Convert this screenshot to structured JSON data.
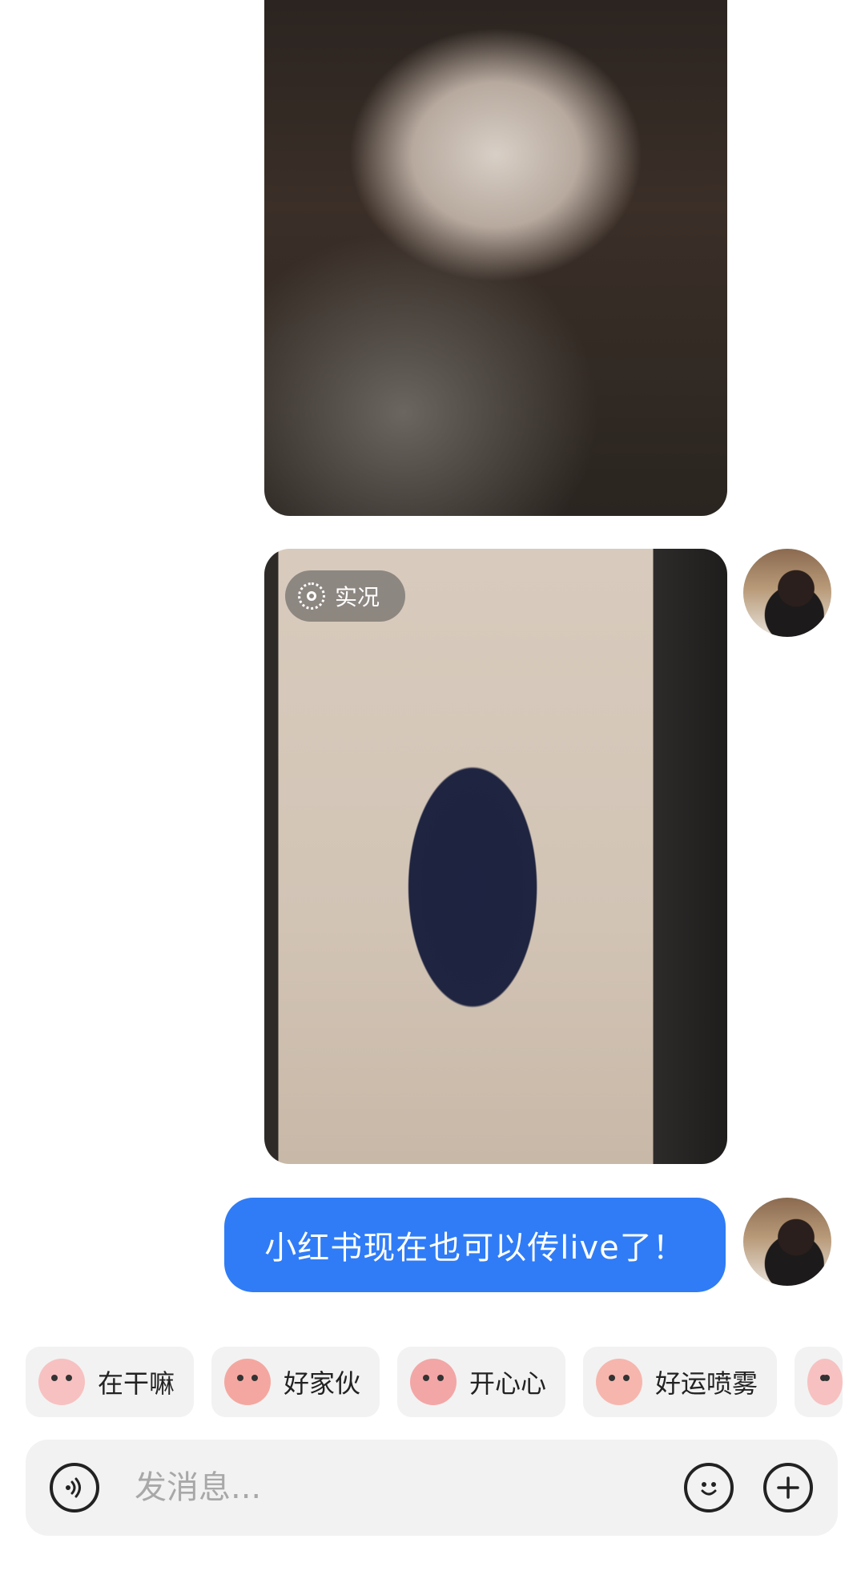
{
  "messages": {
    "live_badge_label": "实况",
    "text_message": "小红书现在也可以传live了！"
  },
  "quick_replies": [
    {
      "label": "在干嘛",
      "sticker": "magnifier-mascot",
      "color": "#f7b7b7"
    },
    {
      "label": "好家伙",
      "sticker": "surprised-mascot",
      "color": "#f4a7a0"
    },
    {
      "label": "开心心",
      "sticker": "heart-mascot",
      "color": "#f3a6a6"
    },
    {
      "label": "好运喷雾",
      "sticker": "spray-mascot",
      "color": "#f6b6ad"
    }
  ],
  "composer": {
    "placeholder": "发消息..."
  },
  "colors": {
    "bubble": "#2f7cf6",
    "chip_bg": "#f2f2f2"
  }
}
